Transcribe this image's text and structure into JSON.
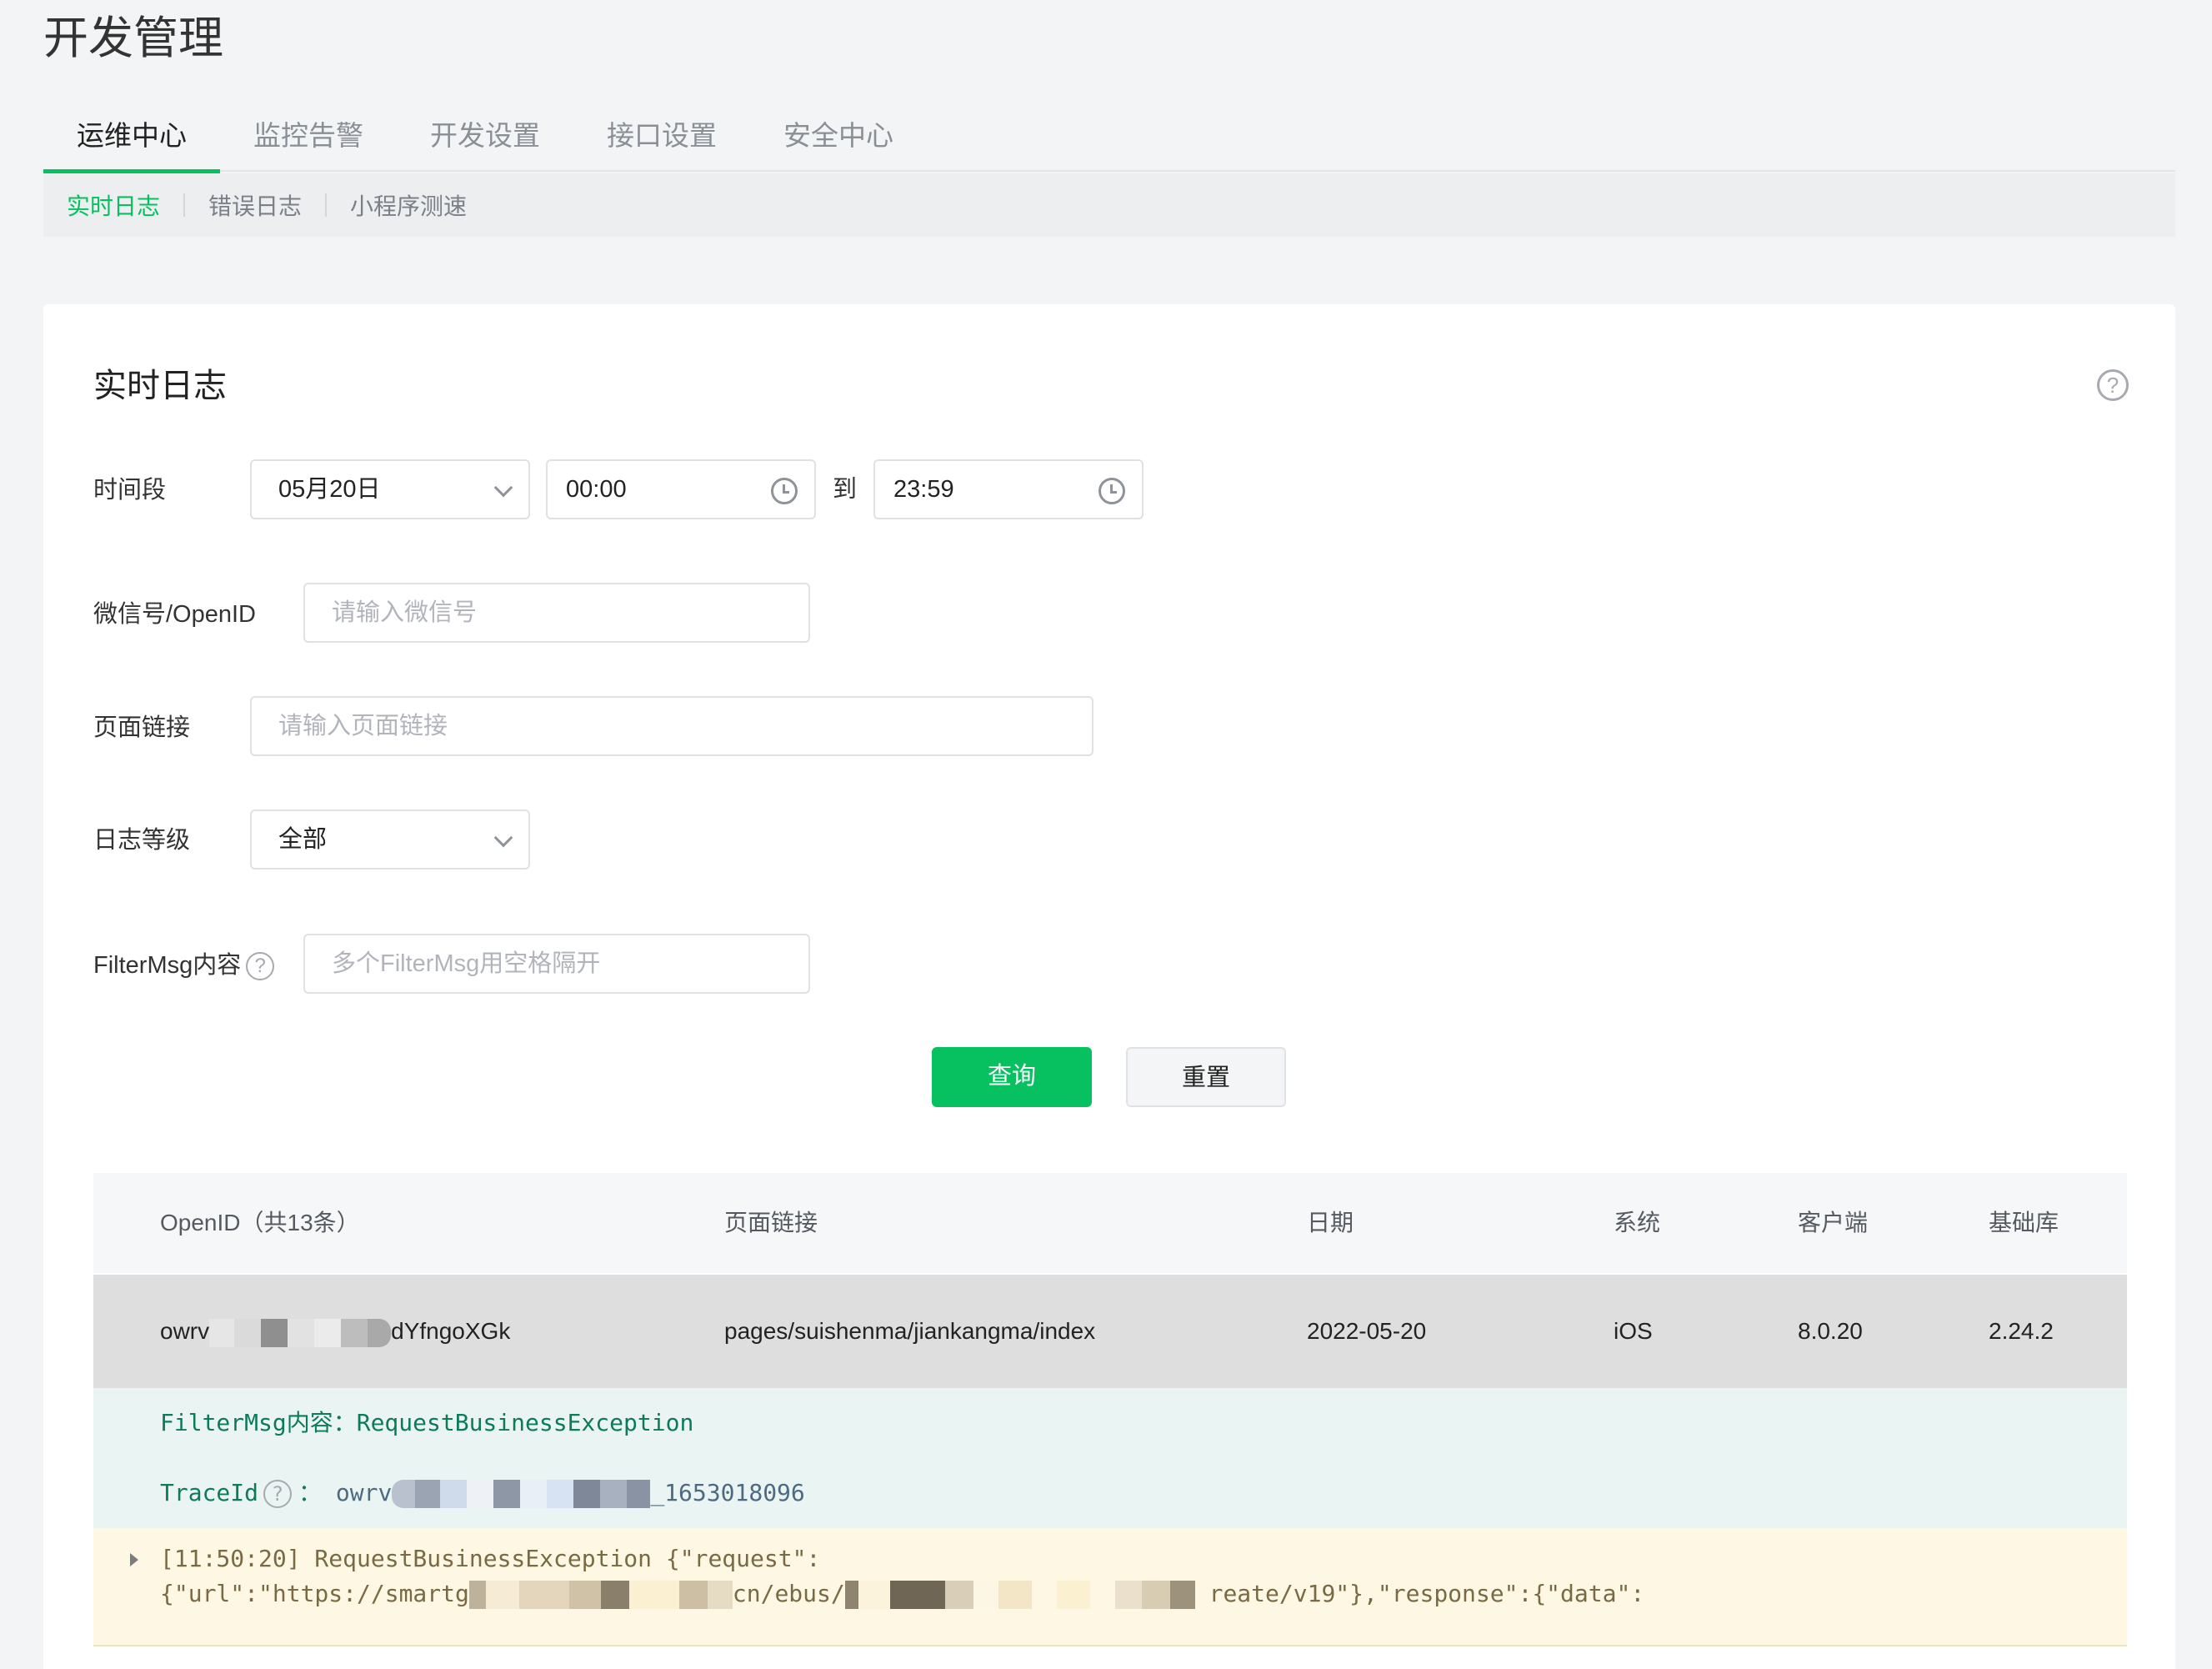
{
  "page": {
    "title": "开发管理"
  },
  "main_tabs": [
    {
      "label": "运维中心",
      "active": true
    },
    {
      "label": "监控告警",
      "active": false
    },
    {
      "label": "开发设置",
      "active": false
    },
    {
      "label": "接口设置",
      "active": false
    },
    {
      "label": "安全中心",
      "active": false
    }
  ],
  "sub_tabs": [
    {
      "label": "实时日志",
      "active": true
    },
    {
      "label": "错误日志",
      "active": false
    },
    {
      "label": "小程序测速",
      "active": false
    }
  ],
  "card": {
    "title": "实时日志",
    "help": "?"
  },
  "form": {
    "time_label": "时间段",
    "date_value": "05月20日",
    "start_time": "00:00",
    "to_label": "到",
    "end_time": "23:59",
    "wechat_label": "微信号/OpenID",
    "wechat_placeholder": "请输入微信号",
    "page_label": "页面链接",
    "page_placeholder": "请输入页面链接",
    "level_label": "日志等级",
    "level_value": "全部",
    "filter_label": "FilterMsg内容",
    "filter_placeholder": "多个FilterMsg用空格隔开",
    "help": "?"
  },
  "buttons": {
    "query": "查询",
    "reset": "重置"
  },
  "table": {
    "headers": {
      "openid": "OpenID（共13条）",
      "page": "页面链接",
      "date": "日期",
      "system": "系统",
      "client": "客户端",
      "lib": "基础库"
    },
    "row": {
      "openid_prefix": "owrv",
      "openid_suffix": "dYfngoXGk",
      "page": "pages/suishenma/jiankangma/index",
      "date": "2022-05-20",
      "system": "iOS",
      "client": "8.0.20",
      "lib": "2.24.2"
    }
  },
  "detail": {
    "filter_line": "FilterMsg内容：RequestBusinessException",
    "trace_label": "TraceId",
    "trace_colon": "：",
    "trace_prefix": "owrv",
    "trace_suffix": "_1653018096",
    "log_line1": "[11:50:20]  RequestBusinessException {\"request\":",
    "log_line2_a": "{\"url\":\"https://smartg",
    "log_line2_b": "cn/ebus/",
    "log_line2_c": "reate/v19\"},\"response\":{\"data\":",
    "help": "?"
  }
}
